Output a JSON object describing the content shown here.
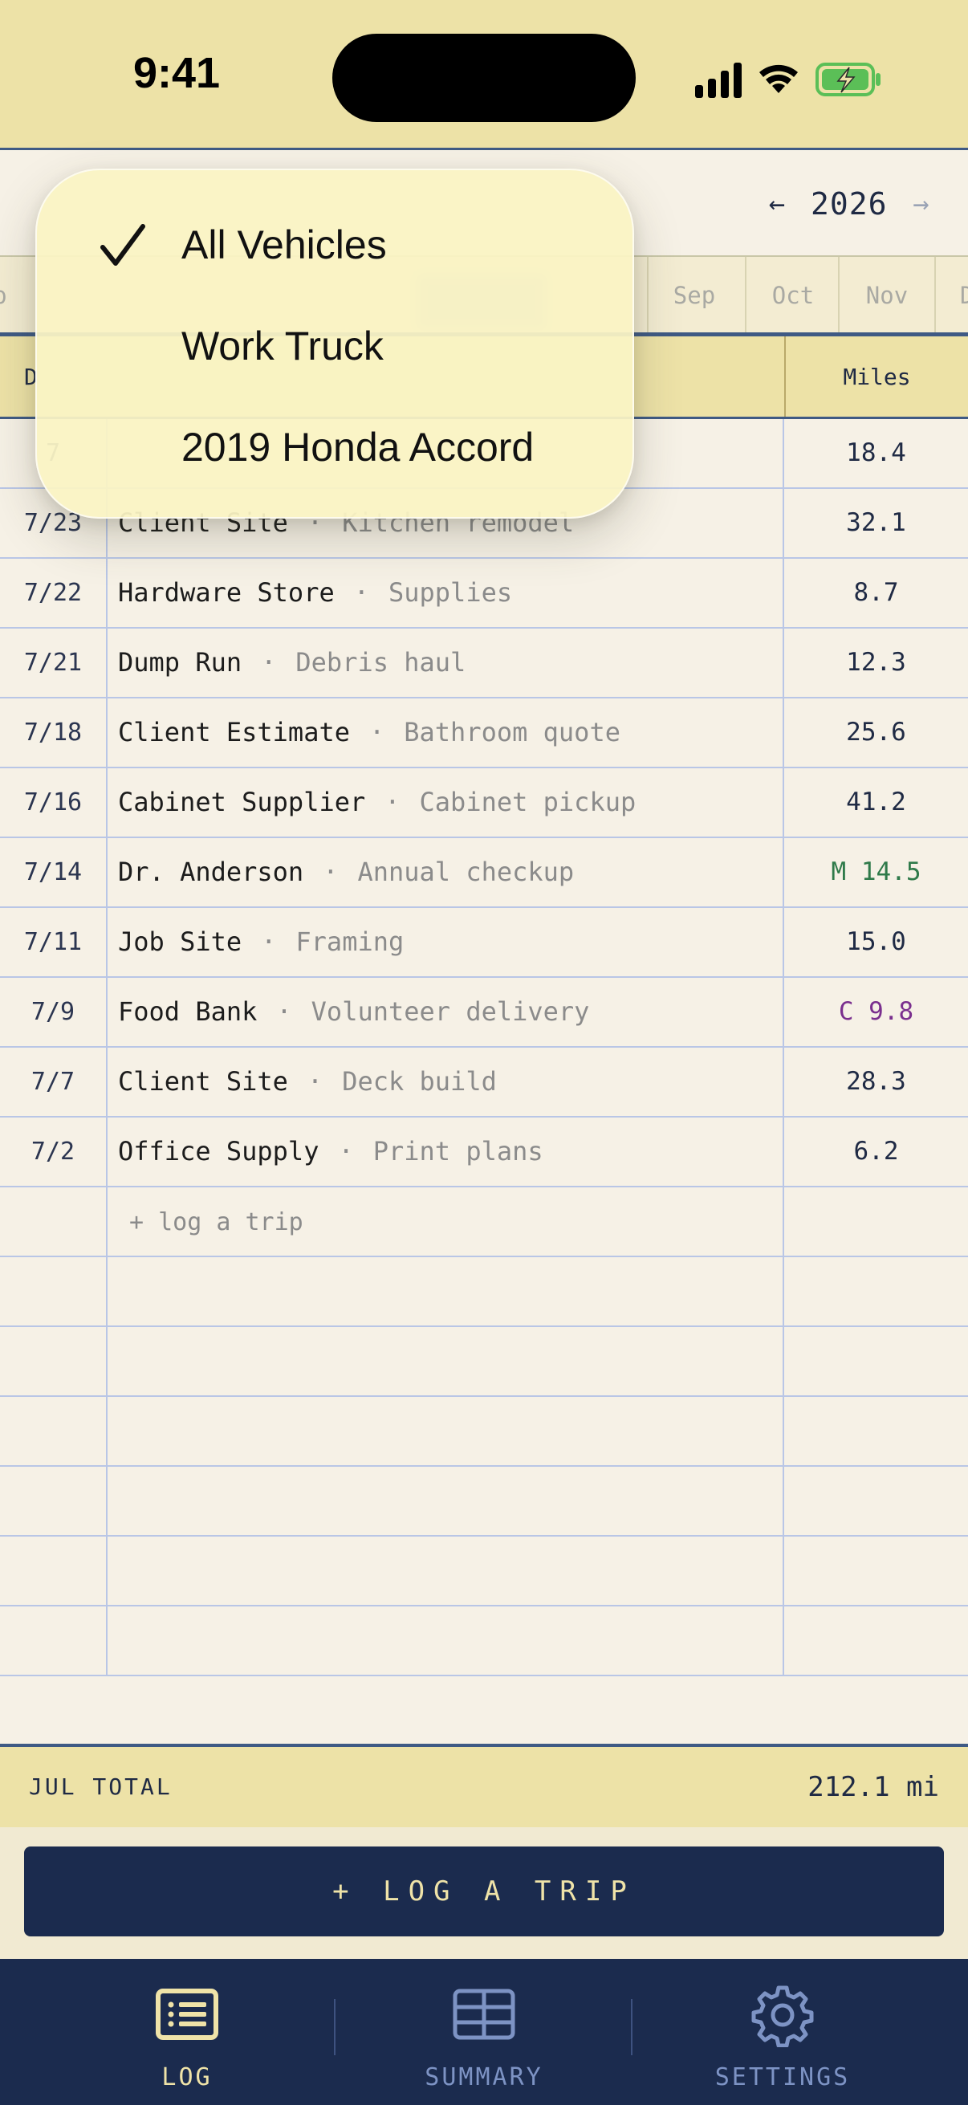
{
  "status_bar": {
    "time": "9:41"
  },
  "header": {
    "year": "2026",
    "prev_icon": "arrow-left-icon",
    "next_icon": "arrow-right-icon"
  },
  "months": [
    {
      "label": "o",
      "state": "partial"
    },
    {
      "label": "Sep",
      "state": "normal"
    },
    {
      "label": "Oct",
      "state": "normal"
    },
    {
      "label": "Nov",
      "state": "normal"
    },
    {
      "label": "D",
      "state": "partial"
    }
  ],
  "table": {
    "header": {
      "date": "D",
      "miles": "Miles"
    },
    "rows": [
      {
        "date": "7",
        "place": "",
        "note": "",
        "miles": "18.4",
        "kind": "business"
      },
      {
        "date": "7/23",
        "place": "Client Site",
        "sep": "·",
        "note": "Kitchen remodel",
        "miles": "32.1",
        "kind": "business"
      },
      {
        "date": "7/22",
        "place": "Hardware Store",
        "sep": "·",
        "note": "Supplies",
        "miles": "8.7",
        "kind": "business"
      },
      {
        "date": "7/21",
        "place": "Dump Run",
        "sep": "·",
        "note": "Debris haul",
        "miles": "12.3",
        "kind": "business"
      },
      {
        "date": "7/18",
        "place": "Client Estimate",
        "sep": "·",
        "note": "Bathroom quote",
        "miles": "25.6",
        "kind": "business"
      },
      {
        "date": "7/16",
        "place": "Cabinet Supplier",
        "sep": "·",
        "note": "Cabinet pickup",
        "miles": "41.2",
        "kind": "business"
      },
      {
        "date": "7/14",
        "place": "Dr. Anderson",
        "sep": "·",
        "note": "Annual checkup",
        "miles": "M 14.5",
        "kind": "medical"
      },
      {
        "date": "7/11",
        "place": "Job Site",
        "sep": "·",
        "note": "Framing",
        "miles": "15.0",
        "kind": "business"
      },
      {
        "date": "7/9",
        "place": "Food Bank",
        "sep": "·",
        "note": "Volunteer delivery",
        "miles": "C 9.8",
        "kind": "charity"
      },
      {
        "date": "7/7",
        "place": "Client Site",
        "sep": "·",
        "note": "Deck build",
        "miles": "28.3",
        "kind": "business"
      },
      {
        "date": "7/2",
        "place": "Office Supply",
        "sep": "·",
        "note": "Print plans",
        "miles": "6.2",
        "kind": "business"
      }
    ],
    "add_row_label": "+ log a trip",
    "empty_rows": 6
  },
  "colors": {
    "medical": "#2f7a4a",
    "charity": "#7a2f8e",
    "accent": "#1b2b4e",
    "header_bg": "#ede2a7"
  },
  "total": {
    "label": "JUL TOTAL",
    "value": "212.1 mi"
  },
  "primary_button": {
    "label": "+ LOG A TRIP"
  },
  "tabs": [
    {
      "label": "LOG",
      "icon": "list-icon",
      "active": true
    },
    {
      "label": "SUMMARY",
      "icon": "table-icon",
      "active": false
    },
    {
      "label": "SETTINGS",
      "icon": "gear-icon",
      "active": false
    }
  ],
  "vehicle_menu": {
    "items": [
      {
        "label": "All Vehicles",
        "selected": true
      },
      {
        "label": "Work Truck",
        "selected": false
      },
      {
        "label": "2019 Honda Accord",
        "selected": false
      }
    ]
  }
}
